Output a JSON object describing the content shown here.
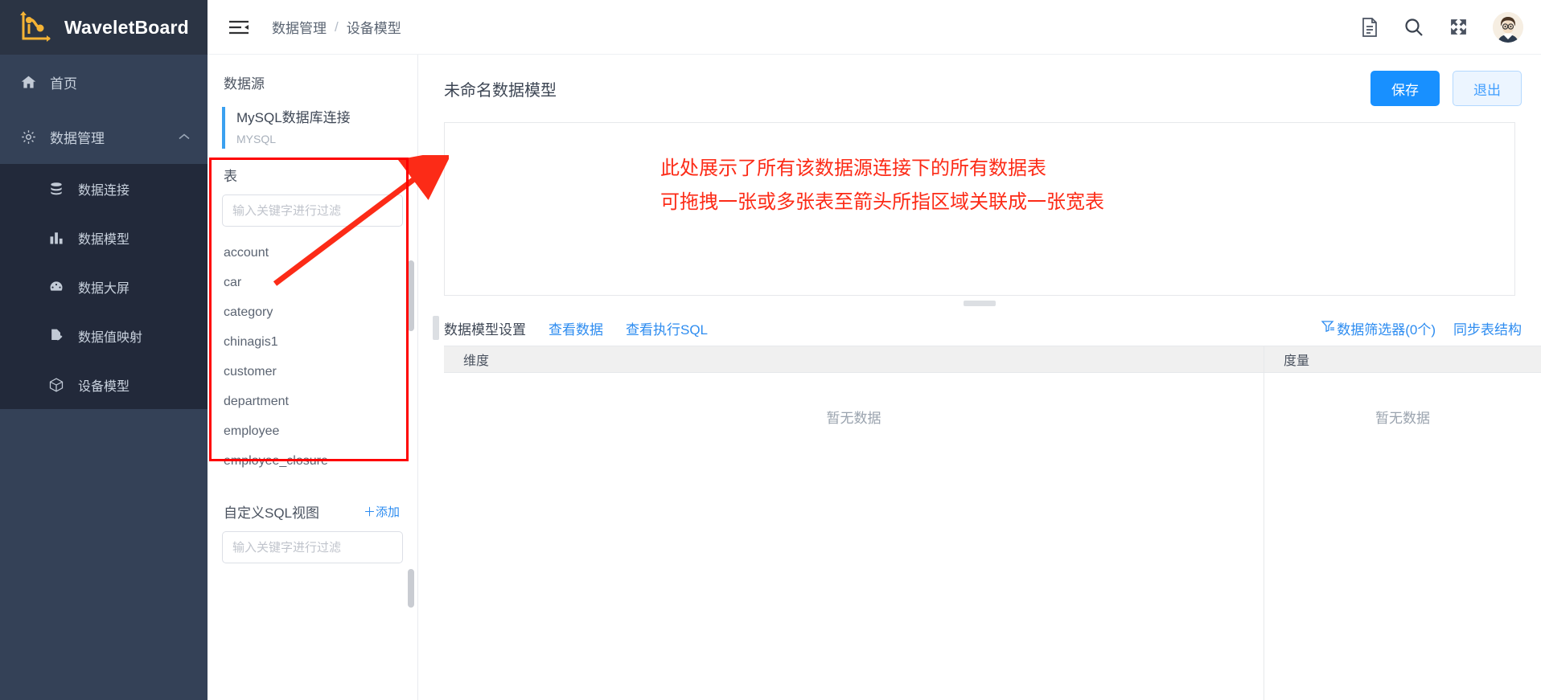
{
  "brand": {
    "name": "WaveletBoard",
    "logo_icon": "wavelet-logo-icon"
  },
  "sidebar": {
    "items": [
      {
        "label": "首页",
        "icon": "home-icon"
      },
      {
        "label": "数据管理",
        "icon": "gear-icon",
        "caret": "⌃"
      }
    ],
    "submenu": [
      {
        "label": "数据连接",
        "icon": "database-icon"
      },
      {
        "label": "数据模型",
        "icon": "bar-chart-icon"
      },
      {
        "label": "数据大屏",
        "icon": "dashboard-icon"
      },
      {
        "label": "数据值映射",
        "icon": "file-edit-icon"
      },
      {
        "label": "设备模型",
        "icon": "cube-icon"
      }
    ]
  },
  "topbar": {
    "collapse_icon": "menu-collapse-icon",
    "breadcrumb": [
      "数据管理",
      "设备模型"
    ],
    "separator": "/",
    "icons": [
      "document-icon",
      "search-icon",
      "fullscreen-icon"
    ],
    "avatar_icon": "user-avatar"
  },
  "datasource_panel": {
    "title": "数据源",
    "entry": {
      "name": "MySQL数据库连接",
      "type": "MYSQL"
    },
    "tables_section": {
      "title": "表",
      "filter_placeholder": "输入关键字进行过滤",
      "filter_value": "",
      "items": [
        "account",
        "car",
        "category",
        "chinagis1",
        "customer",
        "department",
        "employee",
        "employee_closure"
      ]
    },
    "sql_view_section": {
      "title": "自定义SQL视图",
      "add_label": "＋添加",
      "filter_placeholder": "输入关键字进行过滤",
      "filter_value": ""
    }
  },
  "content": {
    "model_title": "未命名数据模型",
    "save_label": "保存",
    "exit_label": "退出",
    "annotation": {
      "line1": "此处展示了所有该数据源连接下的所有数据表",
      "line2": "可拖拽一张或多张表至箭头所指区域关联成一张宽表",
      "color": "#fc2b17"
    },
    "tabs": [
      {
        "label": "数据模型设置",
        "active": true
      },
      {
        "label": "查看数据",
        "active": false
      },
      {
        "label": "查看执行SQL",
        "active": false
      }
    ],
    "tools": [
      {
        "label": "数据筛选器(0个)",
        "icon": "filter-icon"
      },
      {
        "label": "同步表结构",
        "icon": ""
      }
    ],
    "grid": {
      "columns": [
        "维度",
        "度量"
      ],
      "empty_text": "暂无数据"
    }
  },
  "colors": {
    "sidebar_bg": "#344157",
    "sidebar_dark": "#22293a",
    "brand_bg": "#2b3444",
    "accent_blue": "#1890ff",
    "link_blue": "#2d8cf0",
    "annotation_red": "#fc2b17",
    "highlight_red": "#fe0000",
    "logo_yellow": "#f5a623"
  }
}
